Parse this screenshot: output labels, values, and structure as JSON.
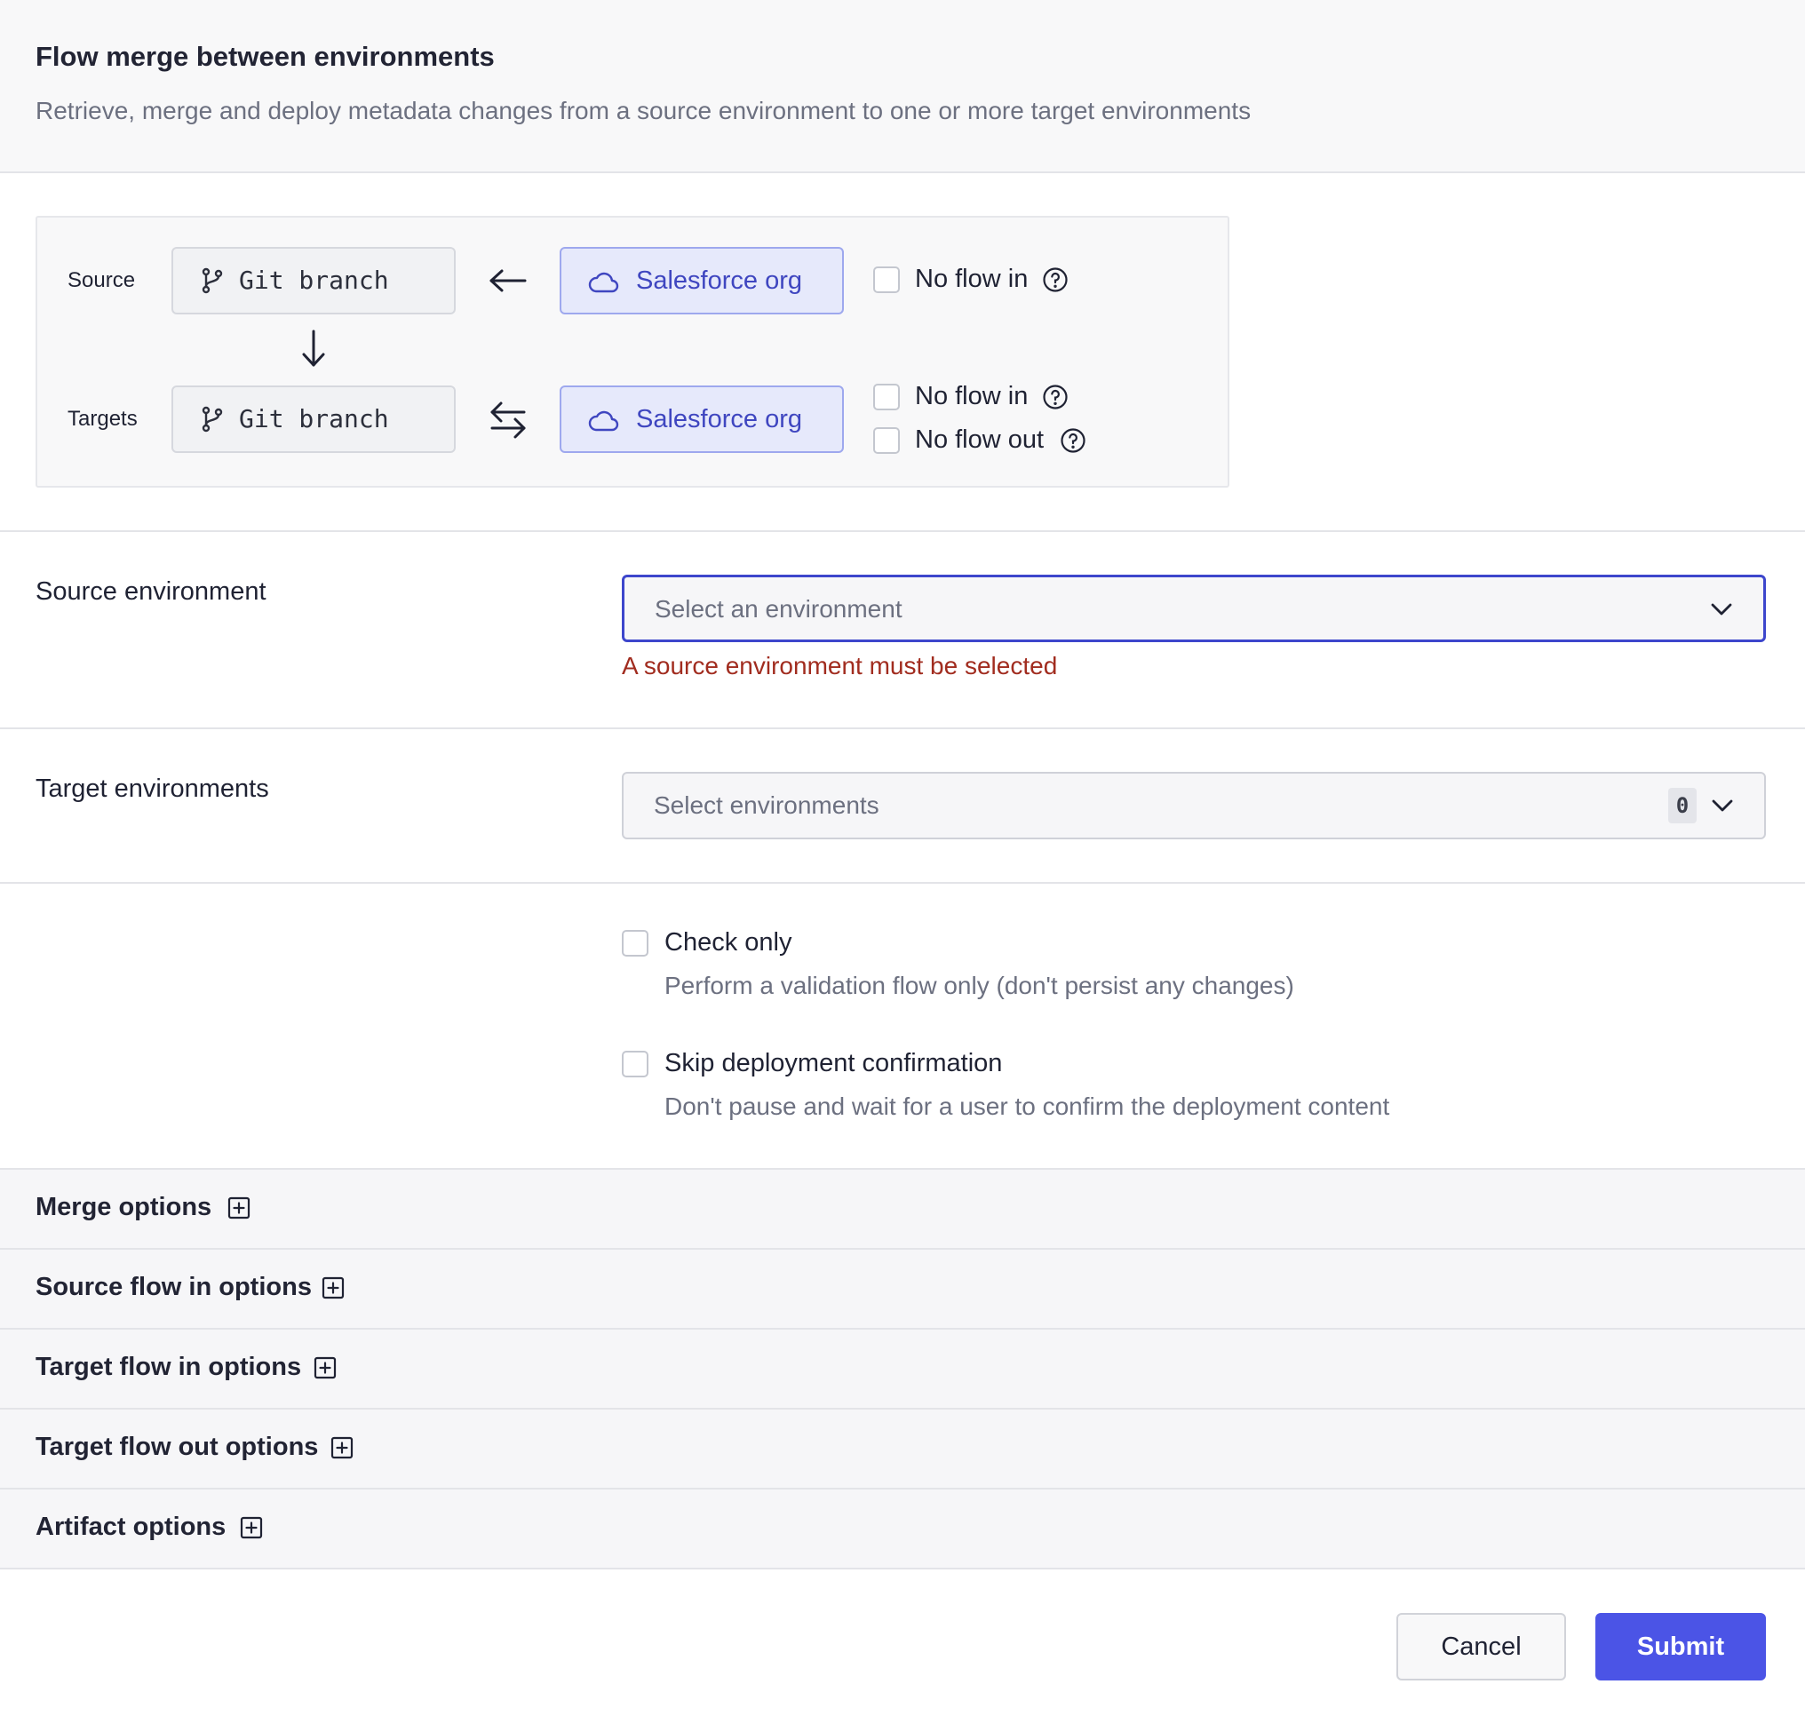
{
  "header": {
    "title": "Flow merge between environments",
    "subtitle": "Retrieve, merge and deploy metadata changes from a source environment to one or more target environments"
  },
  "diagram": {
    "source_label": "Source",
    "targets_label": "Targets",
    "git_branch": "Git branch",
    "salesforce_org": "Salesforce org",
    "no_flow_in": "No flow in",
    "no_flow_out": "No flow out"
  },
  "source_env": {
    "label": "Source environment",
    "placeholder": "Select an environment",
    "error": "A source environment must be selected"
  },
  "target_env": {
    "label": "Target environments",
    "placeholder": "Select environments",
    "count": "0"
  },
  "options": {
    "check_only": {
      "title": "Check only",
      "description": "Perform a validation flow only (don't persist any changes)"
    },
    "skip_confirmation": {
      "title": "Skip deployment confirmation",
      "description": "Don't pause and wait for a user to confirm the deployment content"
    }
  },
  "accordions": {
    "merge": "Merge options",
    "source_flow_in": "Source flow in options",
    "target_flow_in": "Target flow in options",
    "target_flow_out": "Target flow out options",
    "artifact": "Artifact options"
  },
  "footer": {
    "cancel": "Cancel",
    "submit": "Submit"
  },
  "colors": {
    "primary": "#4b54e6",
    "error": "#a12c1f",
    "org_bg": "#e6e9fb"
  }
}
